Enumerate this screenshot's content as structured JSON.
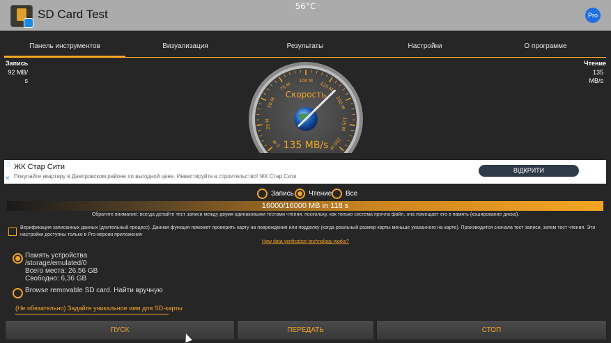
{
  "status": {
    "temperature": "56°C"
  },
  "app": {
    "title": "SD Card Test",
    "pro_label": "Pro"
  },
  "tabs": [
    {
      "label": "Панель инструментов",
      "active": true
    },
    {
      "label": "Визуализация",
      "active": false
    },
    {
      "label": "Результаты",
      "active": false
    },
    {
      "label": "Настройки",
      "active": false
    },
    {
      "label": "О программе",
      "active": false
    }
  ],
  "write": {
    "label": "Запись",
    "value_line1": "92 MB/",
    "value_line2": "s"
  },
  "read": {
    "label": "Чтение",
    "value_line1": "135",
    "value_line2": "MB/s"
  },
  "gauge": {
    "title": "Скорость",
    "value": "135 MB/s",
    "needle_value": 135,
    "max_value": 200,
    "ticks": [
      "0 M",
      "25 M",
      "50 M",
      "75 M",
      "100 M",
      "125 M",
      "150 M",
      "175 M",
      "200 M"
    ]
  },
  "ad": {
    "title": "ЖК Стар Сити",
    "subtitle": "Покупайте квартиру в Днепровском районе по выгодной цене. Инвестируйте в строительство! ЖК Стар Сити",
    "button": "ВІДКРИТИ"
  },
  "modes": [
    {
      "label": "Запись",
      "selected": false
    },
    {
      "label": "Чтение",
      "selected": true
    },
    {
      "label": "Все",
      "selected": false
    }
  ],
  "progress": {
    "text": "16000/16000 MB in 118 s",
    "fraction": 1.0
  },
  "notice": "Обратите внимание: всегда делайте тест записи между двумя одинаковыми тестами чтения, поскольку, как только система прочла файл, она помещает его в память (кэширование диска).",
  "verification": {
    "checked": false,
    "text": "Верификация записанных данных (длительный процесс). Данная функция поможет проверить карту на повреждения или подделку (когда реальный размер карты меньше указанного на карте). Производится сначала тест записи, затем тест чтения. Эти настройки доступны только в Pro-версии приложения",
    "link": "How data verification technology works?"
  },
  "storage": {
    "device": {
      "selected": true,
      "name": "Память устройства",
      "path": "/storage/emulated/0",
      "total": "Всего места: 26,56 GB",
      "free": "Свободно: 6,36 GB"
    },
    "browse": {
      "selected": false,
      "label": "Browse removable SD card. Найти вручную"
    }
  },
  "sd_name_placeholder": "(Не обязательно) Задайте уникальное имя для SD-карты",
  "buttons": {
    "start": "ПУСК",
    "send": "ПЕРЕДАТЬ",
    "stop": "СТОП"
  },
  "colors": {
    "accent": "#f5a623",
    "panel": "#262626",
    "statusbar": "#ababab"
  }
}
